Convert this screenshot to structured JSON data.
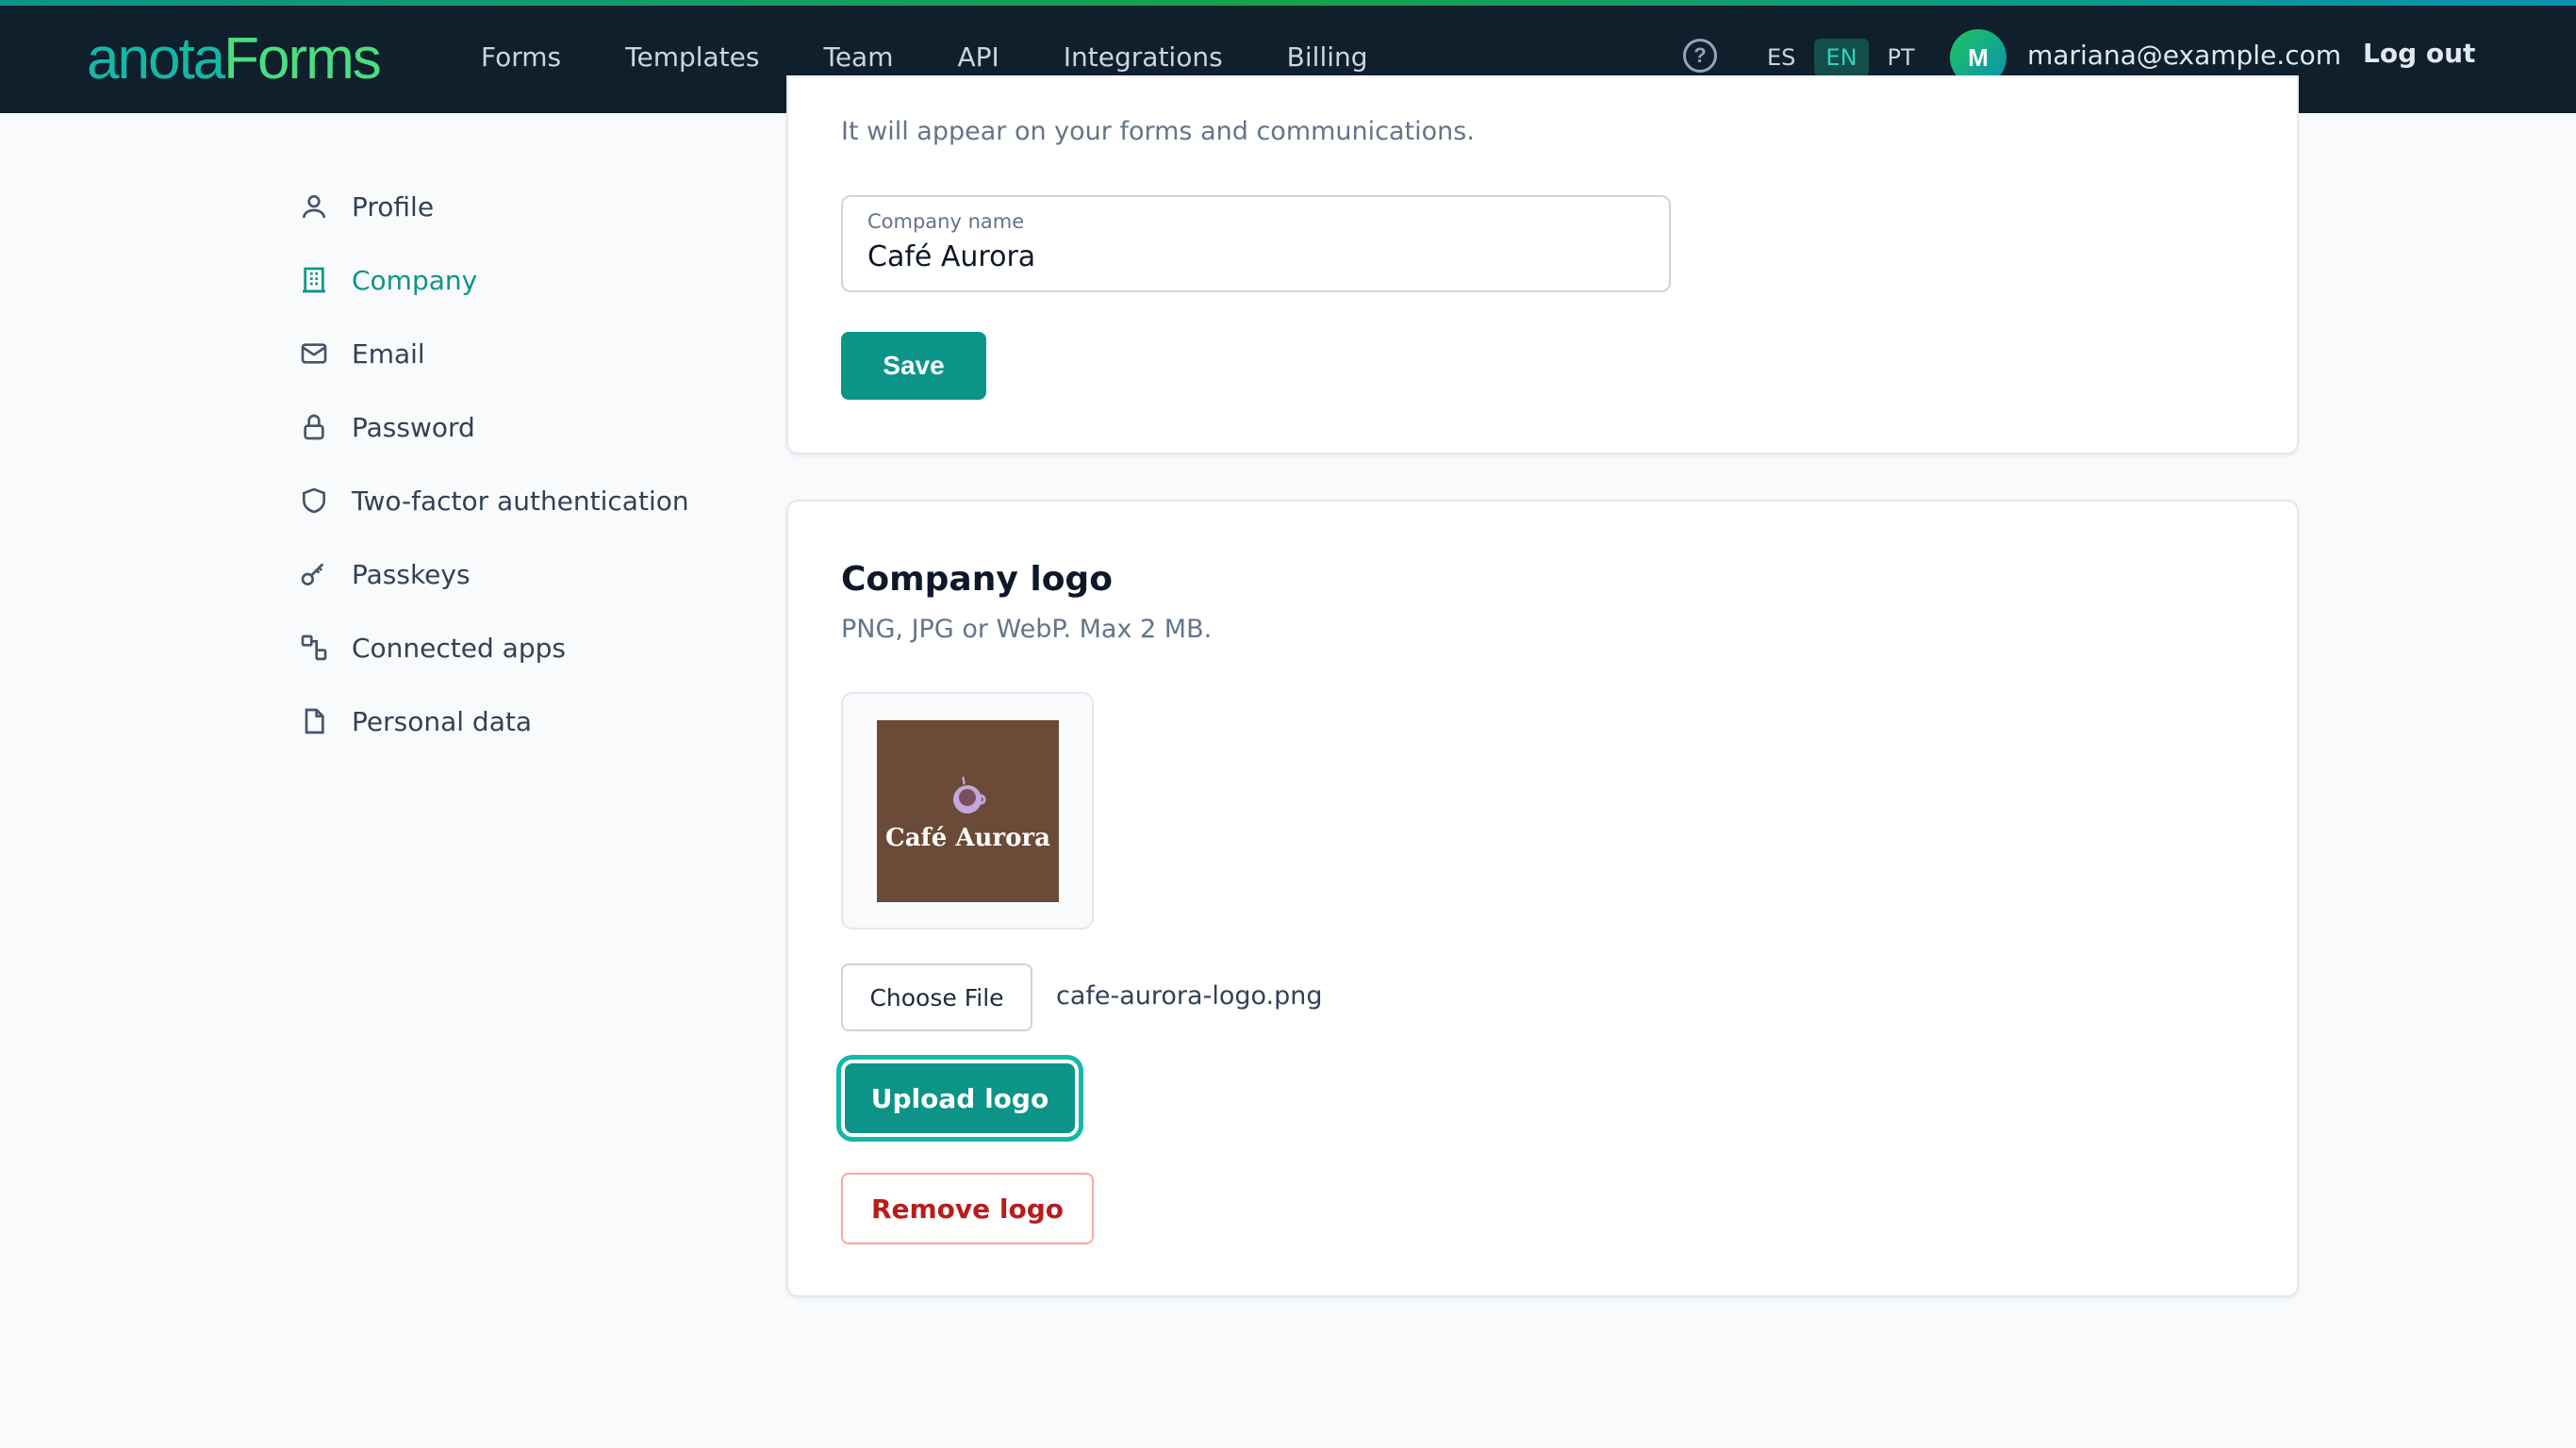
{
  "brand": {
    "part1": "anota",
    "part2": "Forms"
  },
  "nav": [
    "Forms",
    "Templates",
    "Team",
    "API",
    "Integrations",
    "Billing"
  ],
  "header": {
    "help_icon": "question-circle-icon",
    "languages": [
      {
        "code": "ES",
        "active": false
      },
      {
        "code": "EN",
        "active": true
      },
      {
        "code": "PT",
        "active": false
      }
    ],
    "avatar_initial": "M",
    "email": "mariana@example.com",
    "logout": "Log out"
  },
  "sidebar": {
    "items": [
      {
        "label": "Profile",
        "icon": "user-icon",
        "active": false
      },
      {
        "label": "Company",
        "icon": "building-icon",
        "active": true
      },
      {
        "label": "Email",
        "icon": "mail-icon",
        "active": false
      },
      {
        "label": "Password",
        "icon": "lock-icon",
        "active": false
      },
      {
        "label": "Two-factor authentication",
        "icon": "shield-icon",
        "active": false
      },
      {
        "label": "Passkeys",
        "icon": "key-icon",
        "active": false
      },
      {
        "label": "Connected apps",
        "icon": "connected-apps-icon",
        "active": false
      },
      {
        "label": "Personal data",
        "icon": "file-icon",
        "active": false
      }
    ]
  },
  "company_name_section": {
    "description": "It will appear on your forms and communications.",
    "field_label": "Company name",
    "field_value": "Café Aurora",
    "save_button": "Save"
  },
  "company_logo_section": {
    "title": "Company logo",
    "description": "PNG, JPG or WebP. Max 2 MB.",
    "logo_text": "Café Aurora",
    "choose_file_button": "Choose File",
    "file_name": "cafe-aurora-logo.png",
    "upload_button": "Upload logo",
    "remove_button": "Remove logo"
  },
  "colors": {
    "accent": "#0d9488",
    "header_bg": "#0f1f2c",
    "danger": "#b91c1c",
    "logo_bg": "#6b4a37"
  }
}
